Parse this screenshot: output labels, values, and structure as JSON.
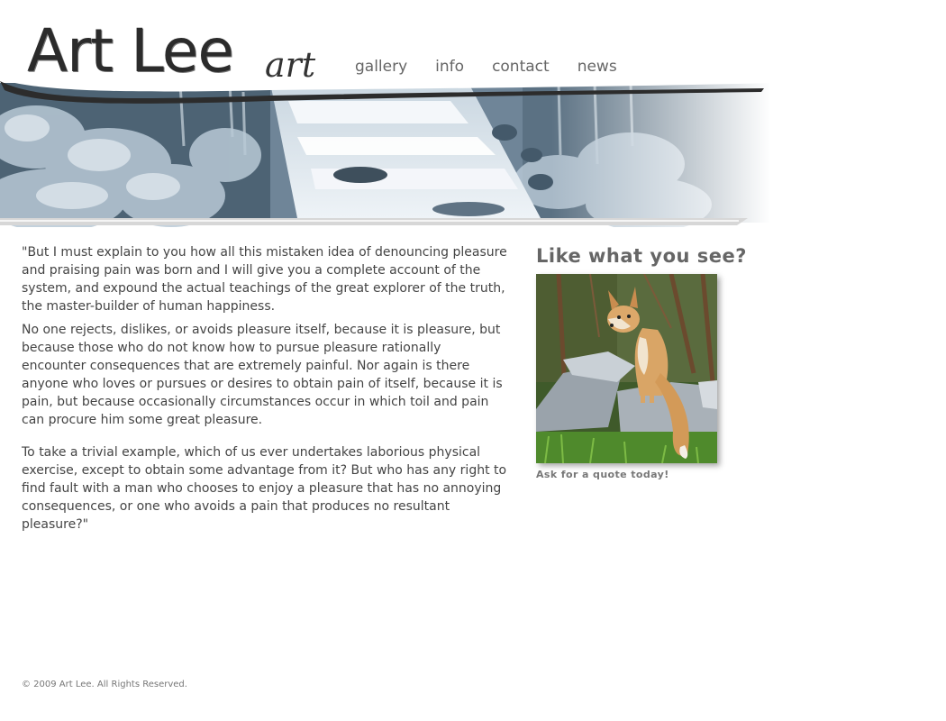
{
  "site": {
    "logo_text": "Art Lee",
    "logo_suffix": "art"
  },
  "nav": {
    "items": [
      {
        "label": "gallery"
      },
      {
        "label": "info"
      },
      {
        "label": "contact"
      },
      {
        "label": "news"
      }
    ]
  },
  "main": {
    "paragraphs": [
      "\"But I must explain to you how all this mistaken idea of denouncing pleasure and praising pain was born and I will give you a complete account of the system, and expound the actual teachings of the great explorer of the truth, the master-builder of human happiness.",
      "No one rejects, dislikes, or avoids pleasure itself, because it is pleasure, but because those who do not know how to pursue pleasure rationally encounter consequences that are extremely painful. Nor again is there anyone who loves or pursues or desires to obtain pain of itself, because it is pain, but because occasionally circumstances occur in which toil and pain can procure him some great pleasure.",
      "To take a trivial example, which of us ever undertakes laborious physical exercise, except to obtain some advantage from it? But who has any right to find fault with a man who chooses to enjoy a pleasure that has no annoying consequences, or one who avoids a pain that produces no resultant pleasure?\""
    ]
  },
  "sidebar": {
    "heading": "Like what you see?",
    "caption": "Ask for a quote today!",
    "image_icon": "fox-painting"
  },
  "footer": {
    "copyright": "© 2009 Art Lee. All Rights Reserved."
  },
  "colors": {
    "nav_text": "#666666",
    "body_text": "#444444",
    "heading": "#666666",
    "banner_dark": "#4f6577",
    "banner_light": "#d8e2ea"
  }
}
